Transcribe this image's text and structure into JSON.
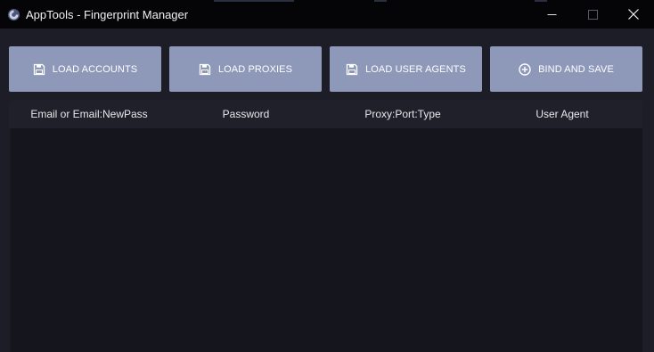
{
  "window": {
    "title": "AppTools - Fingerprint Manager",
    "icon": "app-logo-icon",
    "controls": [
      "minimize-icon",
      "maximize-icon",
      "close-icon"
    ]
  },
  "toolbar": {
    "buttons": [
      {
        "label": "LOAD ACCOUNTS",
        "icon": "save-disk-icon"
      },
      {
        "label": "LOAD PROXIES",
        "icon": "save-disk-icon"
      },
      {
        "label": "LOAD USER AGENTS",
        "icon": "save-disk-icon"
      },
      {
        "label": "BIND AND SAVE",
        "icon": "plus-circle-icon"
      }
    ]
  },
  "grid": {
    "columns": [
      "Email or Email:NewPass",
      "Password",
      "Proxy:Port:Type",
      "User Agent"
    ],
    "rows": []
  },
  "colors": {
    "titlebar": "#050507",
    "background": "#1d1d27",
    "button": "#8e98b9",
    "grid_body": "#15151d",
    "grid_header": "#20202a",
    "text": "#e6e6ea"
  }
}
